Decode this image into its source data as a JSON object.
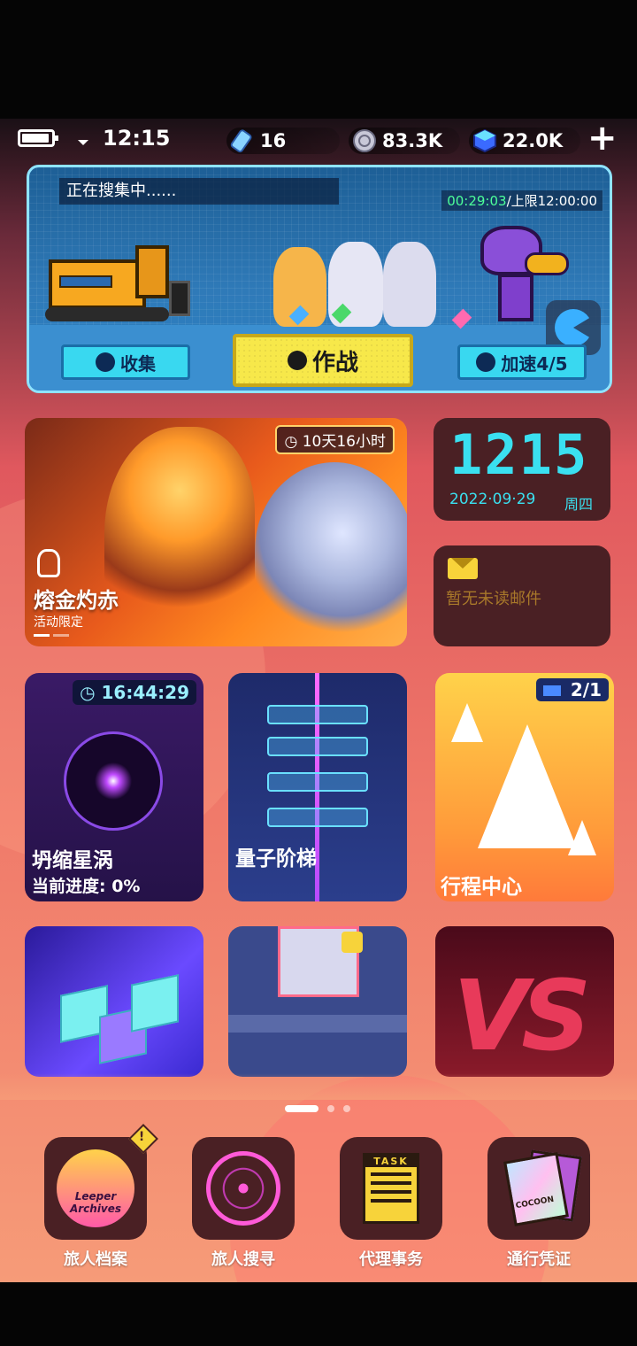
{
  "status_bar": {
    "time": "12:15",
    "resources": [
      {
        "icon": "energy-cell-icon",
        "value": "16"
      },
      {
        "icon": "coin-icon",
        "value": "83.3K"
      },
      {
        "icon": "cube-gem-icon",
        "value": "22.0K"
      }
    ],
    "add_icon": "plus-icon"
  },
  "expedition": {
    "status": "正在搜集中......",
    "elapsed": "00:29:03",
    "limit": "/上限12:00:00",
    "collect_label": "收集",
    "battle_label": "作战",
    "speedup_label": "加速4/5"
  },
  "event_card": {
    "countdown": "10天16小时",
    "title": "熔金灼赤",
    "subtitle": "活动限定"
  },
  "clock_widget": {
    "time": "1215",
    "date": "2022·09·29",
    "weekday": "周四"
  },
  "mail_widget": {
    "text": "暂无未读邮件"
  },
  "tiles": {
    "vortex": {
      "timer": "16:44:29",
      "title": "坍缩星涡",
      "progress": "当前进度:  0%"
    },
    "quantum": {
      "title": "量子阶梯"
    },
    "journey": {
      "badge": "2/1",
      "title": "行程中心"
    },
    "vs": {
      "text": "VS"
    }
  },
  "pager": {
    "current": 1,
    "total": 3
  },
  "dock": [
    {
      "label": "旅人档案",
      "art_text": "Leeper Archives"
    },
    {
      "label": "旅人搜寻"
    },
    {
      "label": "代理事务",
      "art_text": "TASK"
    },
    {
      "label": "通行凭证",
      "art_text": "COCOON"
    }
  ],
  "colors": {
    "accent_cyan": "#3ae0f0",
    "battle_yellow": "#f7e84a",
    "widget_bg": "#4a2024"
  }
}
